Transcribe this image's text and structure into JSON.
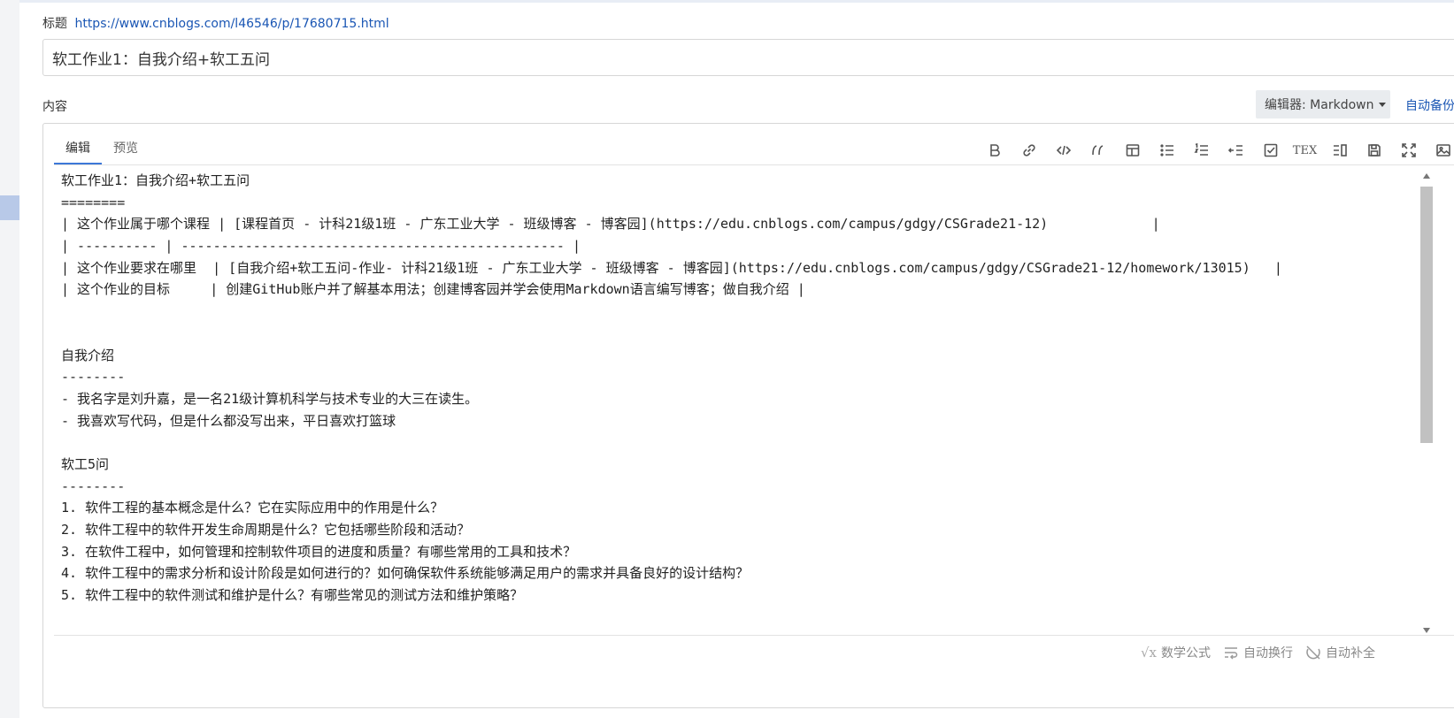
{
  "header": {
    "title_label": "标题",
    "title_url": "https://www.cnblogs.com/l46546/p/17680715.html"
  },
  "title_input": {
    "value": "软工作业1：自我介绍+软工五问"
  },
  "content_label": "内容",
  "editor_switch": {
    "label": "编辑器: Markdown"
  },
  "autobackup_label": "自动备份",
  "tabs": [
    {
      "label": "编辑",
      "active": true
    },
    {
      "label": "预览",
      "active": false
    }
  ],
  "toolbar": [
    {
      "icon": "bold-icon"
    },
    {
      "icon": "link-icon"
    },
    {
      "icon": "code-icon"
    },
    {
      "icon": "quote-icon"
    },
    {
      "icon": "table-icon"
    },
    {
      "icon": "unordered-list-icon"
    },
    {
      "icon": "ordered-list-icon"
    },
    {
      "icon": "indent-icon"
    },
    {
      "icon": "checkbox-icon"
    },
    {
      "icon": "tex-icon",
      "text": "TEX"
    },
    {
      "icon": "toggle-preview-icon"
    },
    {
      "icon": "save-icon"
    },
    {
      "icon": "fullscreen-icon"
    },
    {
      "icon": "image-icon"
    }
  ],
  "editor": {
    "lines": [
      "软工作业1：自我介绍+软工五问",
      "========",
      "| 这个作业属于哪个课程 | [课程首页 - 计科21级1班 - 广东工业大学 - 班级博客 - 博客园](https://edu.cnblogs.com/campus/gdgy/CSGrade21-12)             |",
      "| ---------- | ------------------------------------------------ |",
      "| 这个作业要求在哪里  | [自我介绍+软工五问-作业- 计科21级1班 - 广东工业大学 - 班级博客 - 博客园](https://edu.cnblogs.com/campus/gdgy/CSGrade21-12/homework/13015)   |",
      "| 这个作业的目标     | 创建GitHub账户并了解基本用法；创建博客园并学会使用Markdown语言编写博客；做自我介绍 |",
      "",
      "",
      "自我介绍",
      "--------",
      "- 我名字是刘升嘉，是一名21级计算机科学与技术专业的大三在读生。",
      "- 我喜欢写代码，但是什么都没写出来，平日喜欢打篮球",
      "",
      "软工5问",
      "--------",
      "1. 软件工程的基本概念是什么？它在实际应用中的作用是什么？",
      "2. 软件工程中的软件开发生命周期是什么？它包括哪些阶段和活动？",
      "3. 在软件工程中，如何管理和控制软件项目的进度和质量？有哪些常用的工具和技术？",
      "4. 软件工程中的需求分析和设计阶段是如何进行的？如何确保软件系统能够满足用户的需求并具备良好的设计结构？",
      "5. 软件工程中的软件测试和维护是什么？有哪些常见的测试方法和维护策略？"
    ]
  },
  "status_bar": {
    "math_label": "数学公式",
    "wrap_label": "自动换行",
    "autocomplete_label": "自动补全"
  }
}
